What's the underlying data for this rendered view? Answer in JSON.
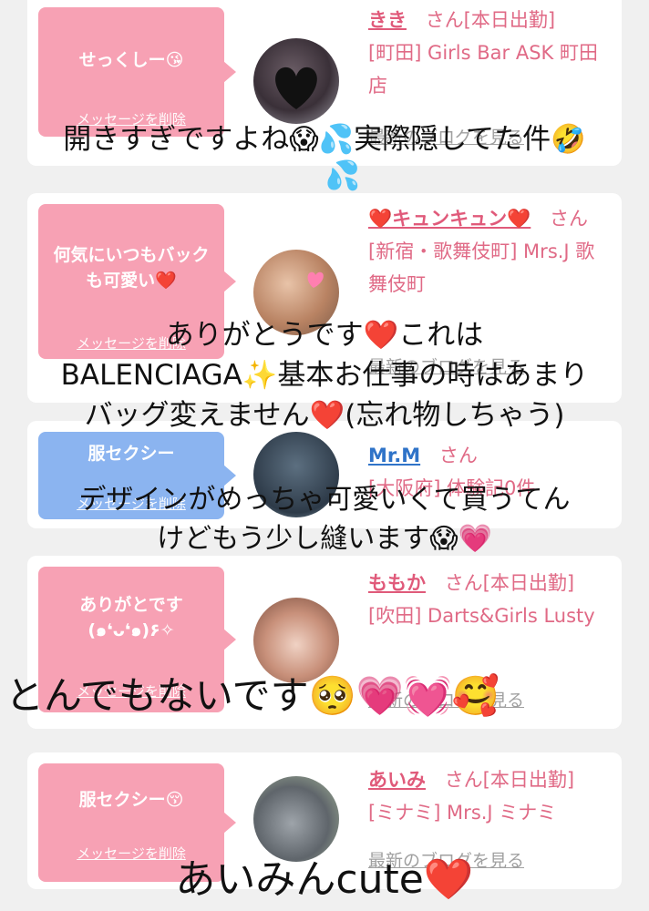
{
  "cards": [
    {
      "bubble": {
        "message": "せっくしー😘",
        "delete_label": "メッセージを削除"
      },
      "name": "きき",
      "honorific": "さん[本日出勤]",
      "shop": "[町田] Girls Bar ASK 町田店",
      "blog_link": "最新のブログを見る"
    },
    {
      "bubble": {
        "message": "何気にいつもバックも可愛い❤️",
        "delete_label": "メッセージを削除"
      },
      "name": "❤️キュンキュン❤️",
      "honorific": "さん",
      "shop": "[新宿・歌舞伎町] Mrs.J 歌舞伎町",
      "blog_link": "最新のブログを見る"
    },
    {
      "bubble": {
        "message": "服セクシー",
        "delete_label": "メッセージを削除"
      },
      "name": "Mr.M",
      "honorific": "さん",
      "shop": "[大阪府] 体験記0件",
      "blog_link": ""
    },
    {
      "bubble": {
        "message": "ありがとです(๑❛ᴗ❛๑)۶✧",
        "delete_label": "メッセージを削除"
      },
      "name": "ももか",
      "honorific": "さん[本日出勤]",
      "shop": "[吹田] Darts&Girls Lusty",
      "blog_link": "最新のブログを見る"
    },
    {
      "bubble": {
        "message": "服セクシー😚",
        "delete_label": "メッセージを削除"
      },
      "name": "あいみ",
      "honorific": "さん[本日出勤]",
      "shop": "[ミナミ] Mrs.J ミナミ",
      "blog_link": "最新のブログを見る"
    }
  ],
  "overlays": {
    "o1_l1": "開きすぎですよね😱💦実際隠してた件🤣",
    "o1_l2": "💦",
    "o2_l1": "ありがとうです❤️これは",
    "o2_l2": "BALENCIAGA✨基本お仕事の時はあまり",
    "o2_l3": "バッグ変えません❤️(忘れ物しちゃう)",
    "o3_l1": "デザインがめっちゃ可愛いくて買うてん",
    "o3_l2": "けどもう少し縫います😱💗",
    "o4": "とんでもないです🥺💗💓🥰",
    "o5": "あいみんcute❤️"
  },
  "colors": {
    "pink_bubble": "#f7a1b4",
    "blue_bubble": "#8bb4f0",
    "name_pink": "#e05a7a",
    "name_blue": "#2f73c8"
  }
}
